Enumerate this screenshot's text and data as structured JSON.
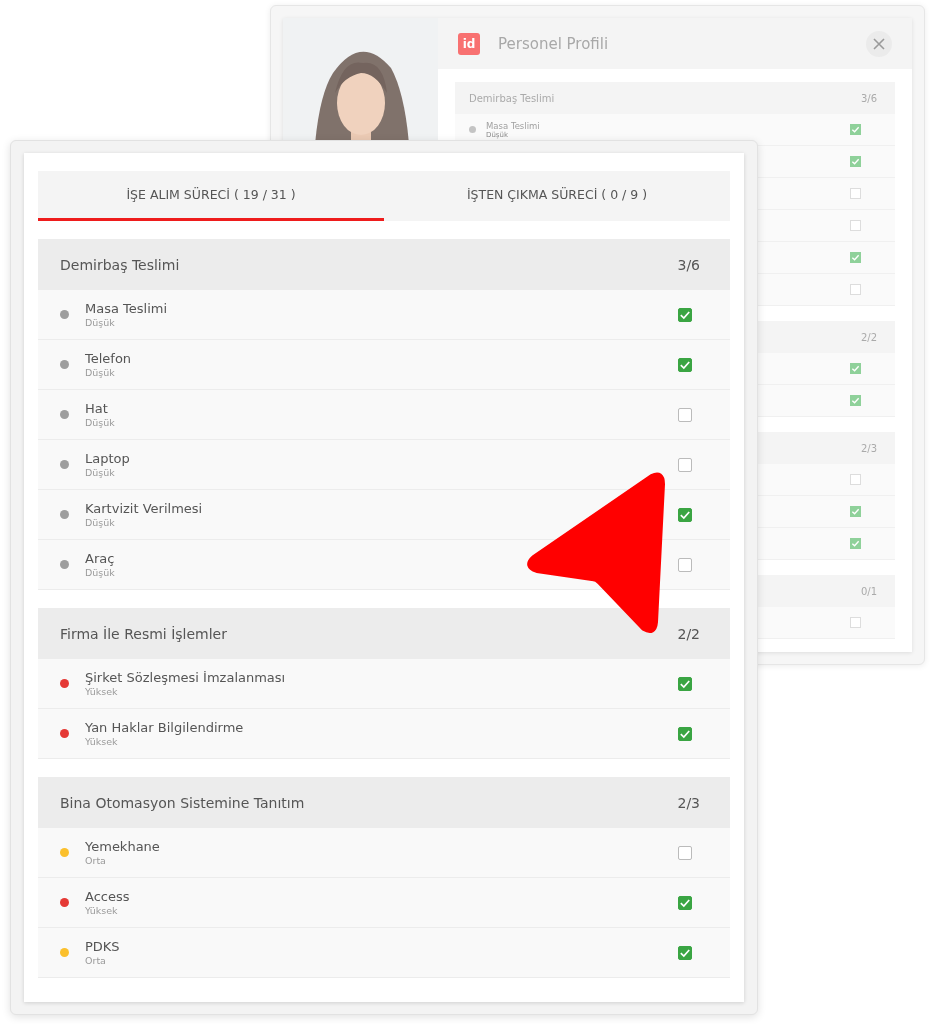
{
  "back_window": {
    "logo": "id",
    "title": "Personel Profili",
    "groups": [
      {
        "title": "Demirbaş Teslimi",
        "count": "3/6",
        "items": [
          {
            "name": "Masa Teslimi",
            "priority": "Düşük",
            "color": "#c4c4c4",
            "checked": true
          },
          {
            "checked": true
          },
          {
            "checked": false
          },
          {
            "checked": false
          },
          {
            "checked": true
          },
          {
            "checked": false
          }
        ]
      },
      {
        "count": "2/2",
        "items": [
          {
            "checked": true
          },
          {
            "checked": true
          }
        ]
      },
      {
        "count": "2/3",
        "items": [
          {
            "checked": false
          },
          {
            "checked": true
          },
          {
            "checked": true
          }
        ]
      },
      {
        "count": "0/1",
        "items": [
          {
            "checked": false
          }
        ]
      }
    ]
  },
  "front_window": {
    "tabs": [
      {
        "label": "İŞE ALIM SÜRECİ ( 19 / 31 )",
        "selected": true
      },
      {
        "label": "İŞTEN ÇIKMA SÜRECİ ( 0 / 9 )",
        "selected": false
      }
    ],
    "groups": [
      {
        "title": "Demirbaş Teslimi",
        "count": "3/6",
        "items": [
          {
            "name": "Masa Teslimi",
            "priority": "Düşük",
            "color": "#9e9e9e",
            "checked": true
          },
          {
            "name": "Telefon",
            "priority": "Düşük",
            "color": "#9e9e9e",
            "checked": true
          },
          {
            "name": "Hat",
            "priority": "Düşük",
            "color": "#9e9e9e",
            "checked": false
          },
          {
            "name": "Laptop",
            "priority": "Düşük",
            "color": "#9e9e9e",
            "checked": false
          },
          {
            "name": "Kartvizit Verilmesi",
            "priority": "Düşük",
            "color": "#9e9e9e",
            "checked": true
          },
          {
            "name": "Araç",
            "priority": "Düşük",
            "color": "#9e9e9e",
            "checked": false
          }
        ]
      },
      {
        "title": "Firma İle Resmi İşlemler",
        "count": "2/2",
        "items": [
          {
            "name": "Şirket Sözleşmesi İmzalanması",
            "priority": "Yüksek",
            "color": "#e53935",
            "checked": true
          },
          {
            "name": "Yan Haklar Bilgilendirme",
            "priority": "Yüksek",
            "color": "#e53935",
            "checked": true
          }
        ]
      },
      {
        "title": "Bina Otomasyon Sistemine Tanıtım",
        "count": "2/3",
        "items": [
          {
            "name": "Yemekhane",
            "priority": "Orta",
            "color": "#fbc02d",
            "checked": false
          },
          {
            "name": "Access",
            "priority": "Yüksek",
            "color": "#e53935",
            "checked": true
          },
          {
            "name": "PDKS",
            "priority": "Orta",
            "color": "#fbc02d",
            "checked": true
          }
        ]
      }
    ]
  }
}
